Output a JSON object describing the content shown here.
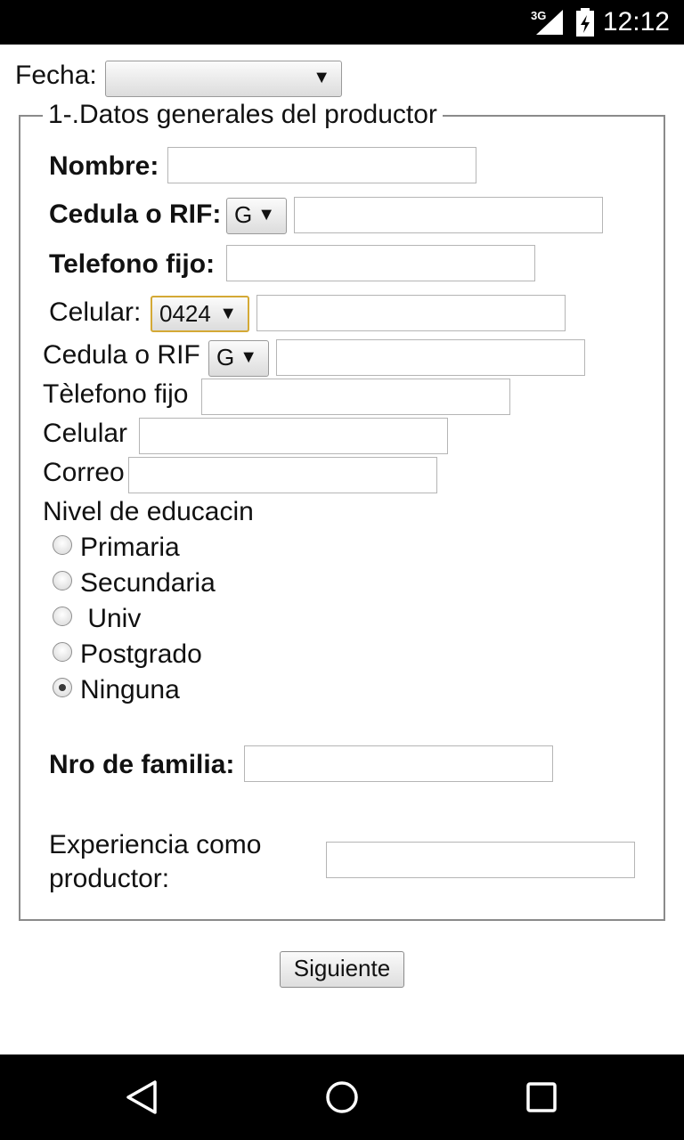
{
  "status_bar": {
    "network": "3G",
    "time": "12:12"
  },
  "date_row": {
    "label": "Fecha:",
    "selected": ""
  },
  "section": {
    "legend": "1-.Datos generales del productor",
    "nombre_label": "Nombre:",
    "nombre_value": "",
    "cedula_bold_label": "Cedula o RIF:",
    "cedula_bold_prefix": "G",
    "cedula_bold_value": "",
    "telefono_bold_label": "Telefono fijo:",
    "telefono_bold_value": "",
    "celular_label": "Celular:",
    "celular_prefix": "0424",
    "celular_value": "",
    "cedula_label": "Cedula o RIF",
    "cedula_prefix": "G",
    "cedula_value": "",
    "telefono_label": "Tèlefono fijo",
    "telefono_value": "",
    "celular2_label": "Celular",
    "celular2_value": "",
    "correo_label": "Correo",
    "correo_value": "",
    "educacion_label": "Nivel de educacin",
    "educacion_options": [
      "Primaria",
      "Secundaria",
      " Univ",
      "Postgrado",
      "Ninguna"
    ],
    "educacion_selected": "Ninguna",
    "familia_label": "Nro de familia:",
    "familia_value": "",
    "experiencia_label_line1": "Experiencia como",
    "experiencia_label_line2": "productor:",
    "experiencia_value": ""
  },
  "buttons": {
    "next": "Siguiente"
  }
}
